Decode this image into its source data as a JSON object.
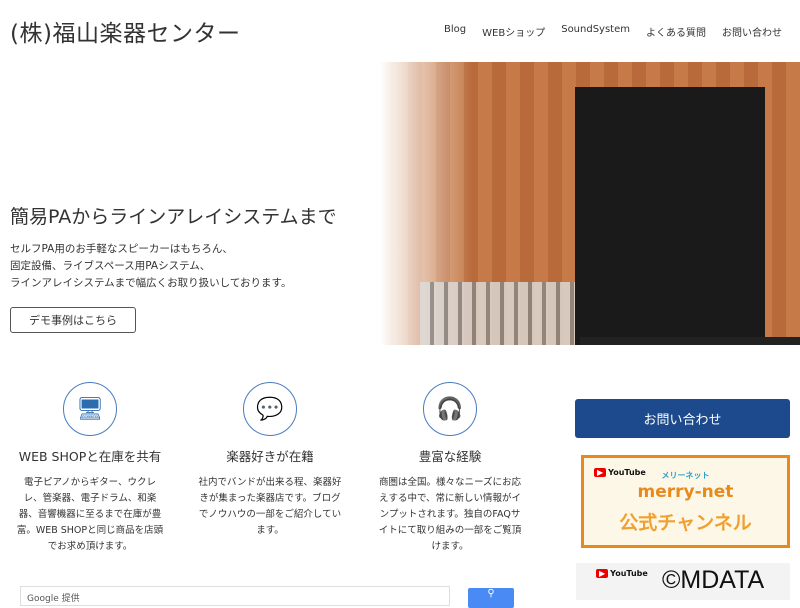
{
  "header": {
    "logo": "(株)福山楽器センター",
    "nav": [
      "Blog",
      "WEBショップ",
      "SoundSystem",
      "よくある質問",
      "お問い合わせ"
    ]
  },
  "hero": {
    "title": "簡易PAからラインアレイシステムまで",
    "lines": [
      "セルフPA用のお手軽なスピーカーはもちろん、",
      "固定設備、ライブスペース用PAシステム、",
      "ラインアレイシステムまで幅広くお取り扱いしております。"
    ],
    "button": "デモ事例はこちら"
  },
  "features": [
    {
      "icon": "monitor-icon",
      "title": "WEB SHOPと在庫を共有",
      "desc": "電子ピアノからギター、ウクレレ、管楽器、電子ドラム、和楽器、音響機器に至るまで在庫が豊富。WEB SHOPと同じ商品を店頭でお求め頂けます。"
    },
    {
      "icon": "chat-icon",
      "title": "楽器好きが在籍",
      "desc": "社内でバンドが出来る程、楽器好きが集まった楽器店です。ブログでノウハウの一部をご紹介しています。"
    },
    {
      "icon": "headset-icon",
      "title": "豊富な経験",
      "desc": "商圏は全国。様々なニーズにお応えする中で、常に新しい情報がインプットされます。独自のFAQサイトにて取り組みの一部をご覧頂けます。"
    }
  ],
  "sidebar": {
    "contact": "お問い合わせ",
    "banner": {
      "youtube": "YouTube",
      "sub": "メリーネット",
      "name": "merry-net",
      "channel": "公式チャンネル"
    },
    "banner2_youtube": "YouTube"
  },
  "search": {
    "placeholder": "Google 提供",
    "button_icon": "search-icon"
  },
  "watermark": "©MDATA"
}
